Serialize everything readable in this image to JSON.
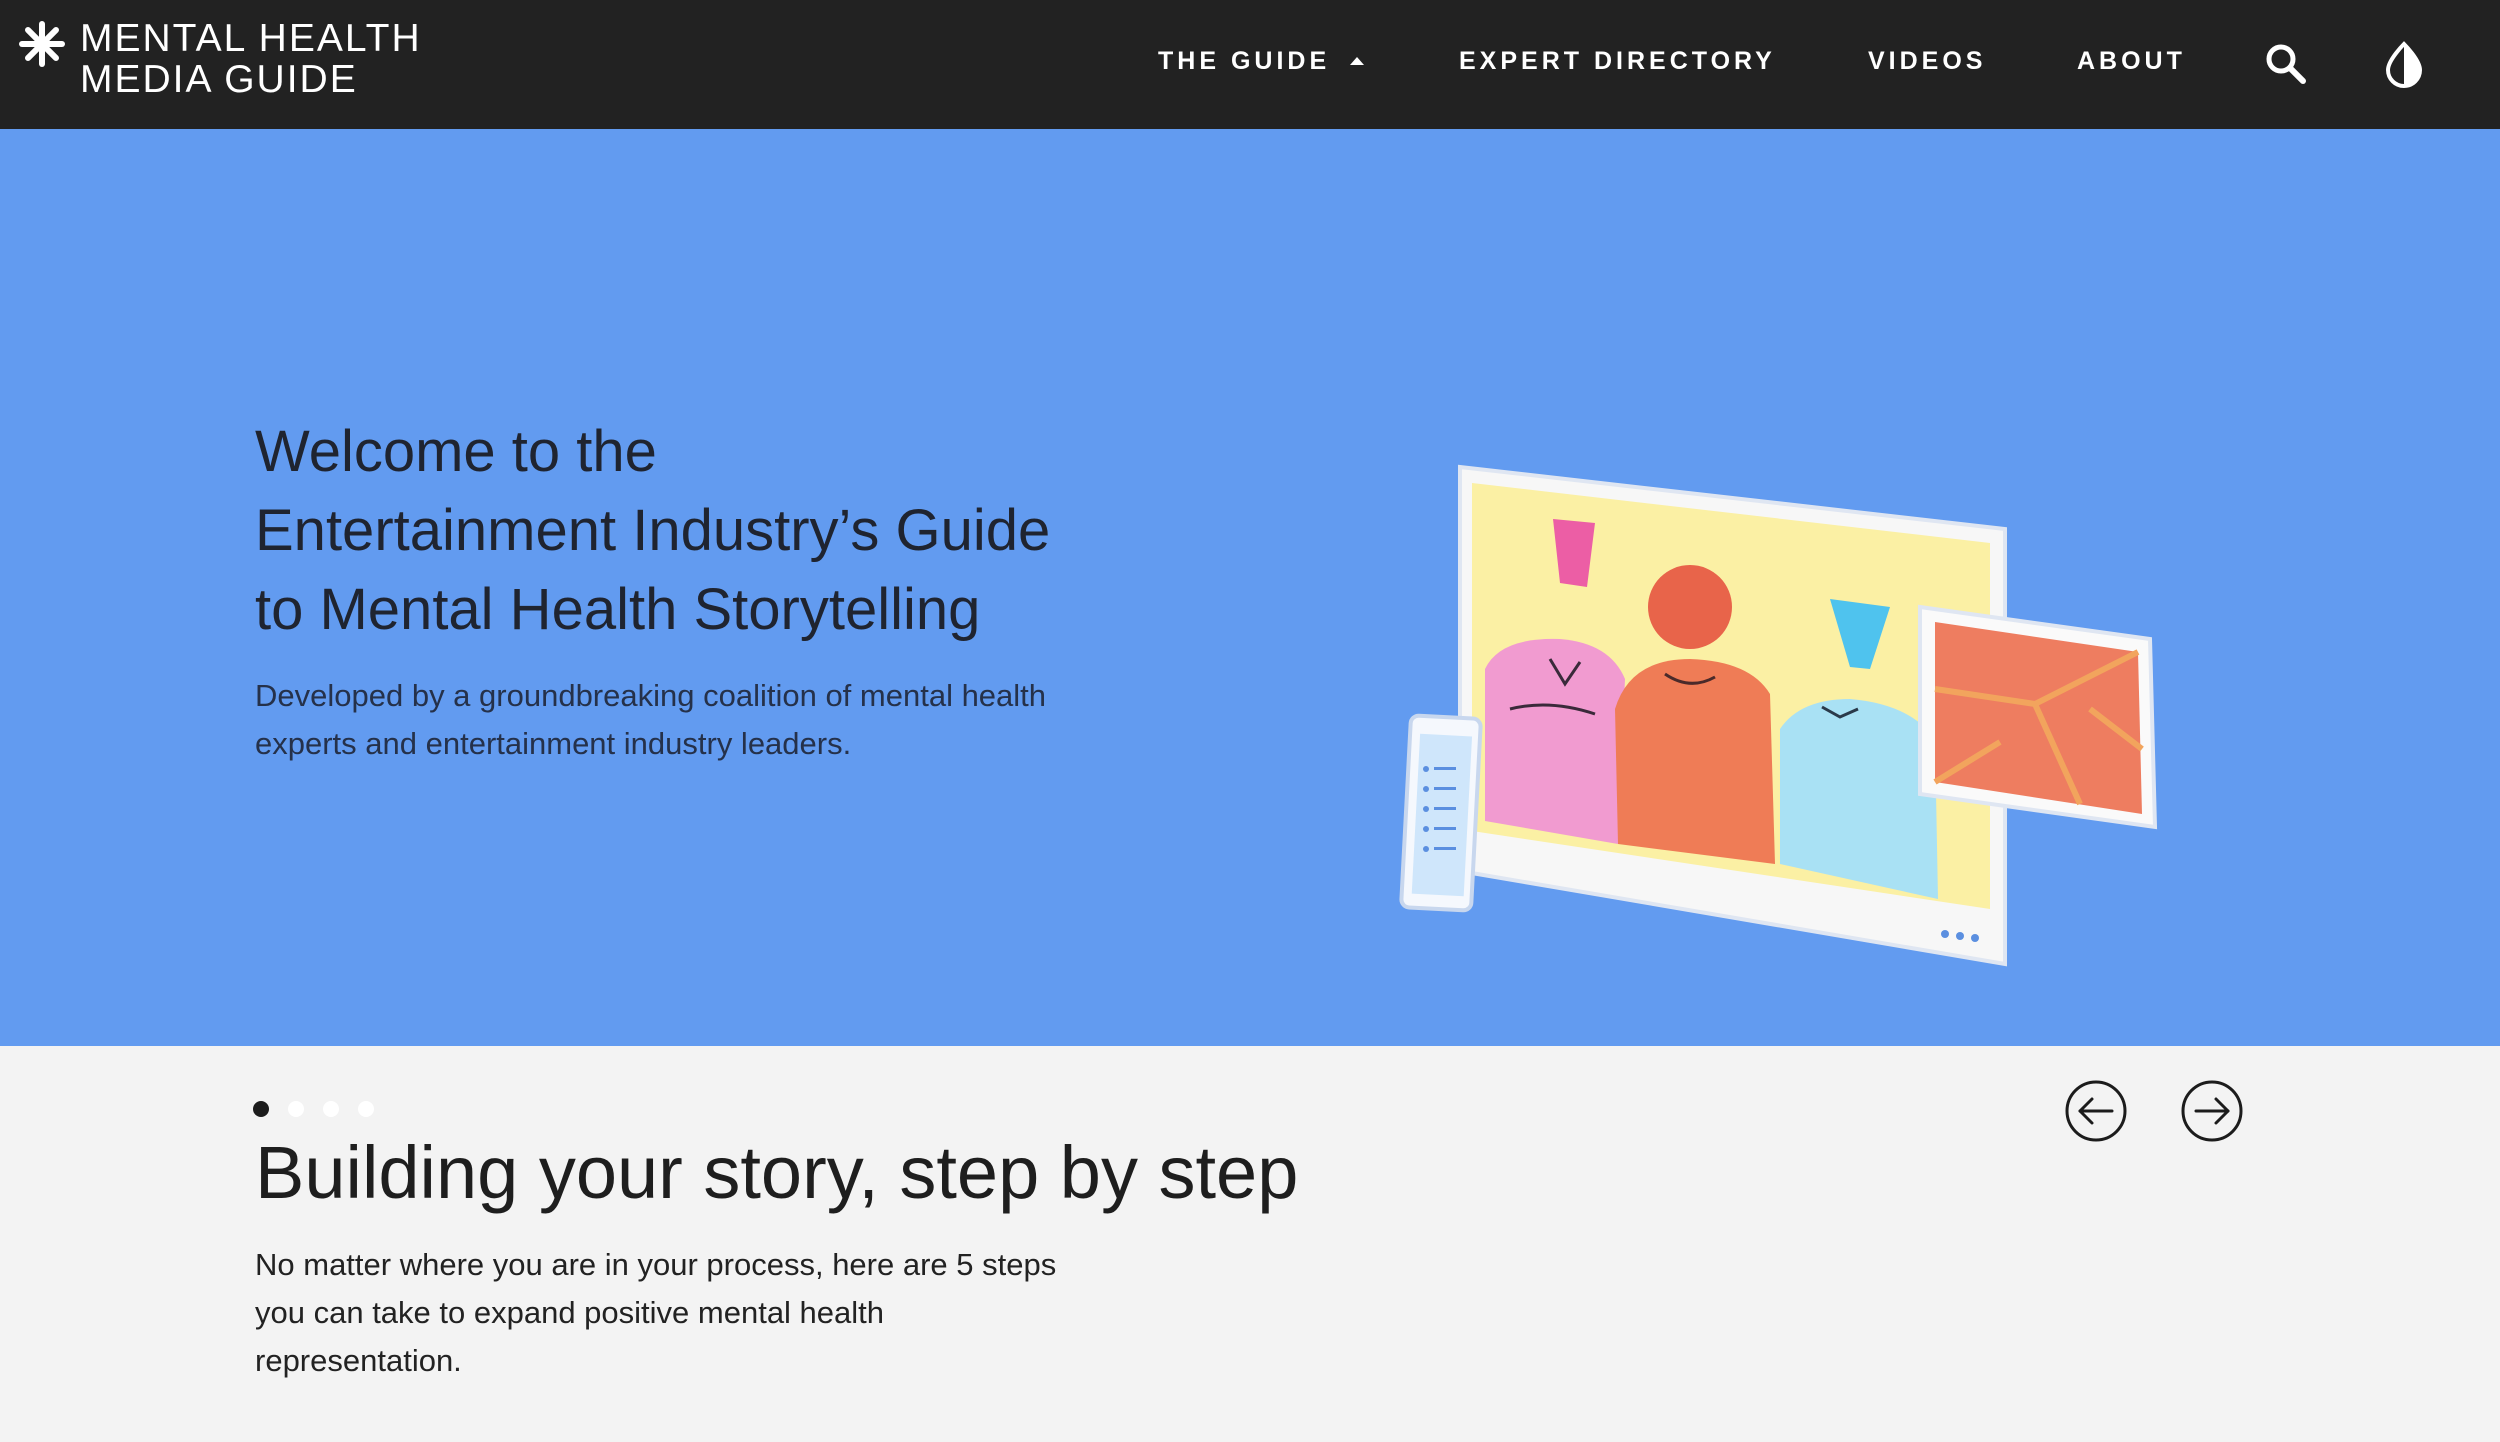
{
  "nav": {
    "logo_line1": "MENTAL HEALTH",
    "logo_line2": "MEDIA GUIDE",
    "items": [
      {
        "label": "THE GUIDE"
      },
      {
        "label": "EXPERT DIRECTORY"
      },
      {
        "label": "VIDEOS"
      },
      {
        "label": "ABOUT"
      }
    ],
    "icons": [
      "asterisk-logo-icon",
      "caret-up-icon",
      "search-icon",
      "contrast-icon"
    ]
  },
  "hero": {
    "title_lines": [
      "Welcome to the",
      "Entertainment Industry’s Guide",
      "to Mental Health Storytelling"
    ],
    "subtitle_lines": [
      "Developed by a groundbreaking coalition of mental health",
      "experts and entertainment industry leaders."
    ],
    "slide_count": 4,
    "active_slide": 1,
    "prev_icon": "arrow-left-circle-icon",
    "next_icon": "arrow-right-circle-icon"
  },
  "steps_section": {
    "title": "Building your story, step by step",
    "text_lines": [
      "No matter where you are in your process, here are 5 steps",
      "you can take to expand positive mental health",
      "representation."
    ]
  },
  "colors": {
    "nav_bg": "#222222",
    "hero_bg": "#629bf0",
    "section_bg": "#f3f3f3",
    "active_dot": "#1c1c1c",
    "inactive_dot": "#ffffff"
  }
}
